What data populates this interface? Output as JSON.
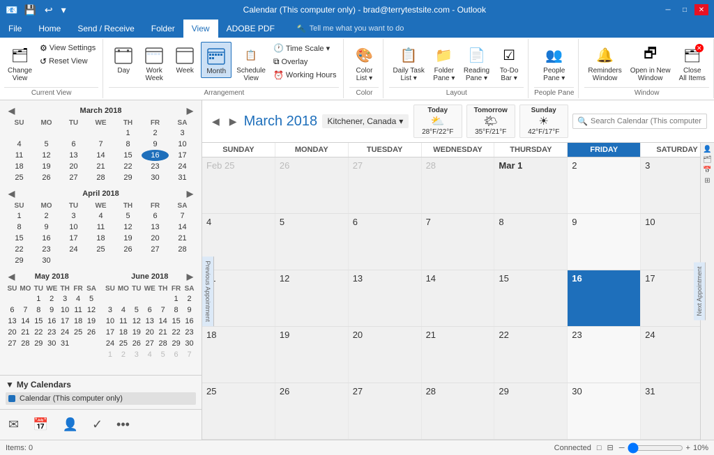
{
  "titleBar": {
    "title": "Calendar (This computer only) - brad@terrytestsite.com - Outlook",
    "controls": [
      "minimize",
      "maximize",
      "close"
    ]
  },
  "quickAccess": {
    "icons": [
      "save",
      "undo",
      "customize"
    ]
  },
  "ribbonTabs": {
    "tabs": [
      "File",
      "Home",
      "Send / Receive",
      "Folder",
      "View",
      "ADOBE PDF"
    ],
    "activeTab": "View",
    "tellMe": "Tell me what you want to do"
  },
  "ribbonGroups": {
    "currentView": {
      "label": "Current View",
      "buttons": [
        {
          "id": "change-view",
          "label": "Change\nView",
          "icon": "🗂"
        },
        {
          "id": "view-settings",
          "label": "View\nSettings",
          "icon": "⚙"
        },
        {
          "id": "reset-view",
          "label": "Reset\nView",
          "icon": "↺"
        }
      ]
    },
    "arrangement": {
      "label": "Arrangement",
      "buttons": [
        {
          "id": "day",
          "label": "Day",
          "icon": "📅"
        },
        {
          "id": "work-week",
          "label": "Work\nWeek",
          "icon": "📅"
        },
        {
          "id": "week",
          "label": "Week",
          "icon": "📅"
        },
        {
          "id": "month",
          "label": "Month",
          "icon": "📅",
          "active": true
        },
        {
          "id": "schedule-view",
          "label": "Schedule\nView",
          "icon": "📋"
        }
      ],
      "smallButtons": [
        {
          "id": "time-scale",
          "label": "Time Scale ▾"
        },
        {
          "id": "overlay",
          "label": "Overlay"
        },
        {
          "id": "working-hours",
          "label": "Working Hours"
        }
      ]
    },
    "color": {
      "label": "Color",
      "buttons": [
        {
          "id": "color",
          "label": "Color\nList ▾",
          "icon": "🎨"
        }
      ]
    },
    "layout": {
      "label": "Layout",
      "buttons": [
        {
          "id": "daily-task-list",
          "label": "Daily Task\nList ▾",
          "icon": "📋"
        },
        {
          "id": "folder-pane",
          "label": "Folder\nPane ▾",
          "icon": "📁"
        },
        {
          "id": "reading-pane",
          "label": "Reading\nPane ▾",
          "icon": "📄"
        },
        {
          "id": "todo-bar",
          "label": "To-Do\nBar ▾",
          "icon": "☑"
        }
      ]
    },
    "peoplePane": {
      "label": "People Pane",
      "buttons": [
        {
          "id": "people-pane",
          "label": "People\nPane ▾",
          "icon": "👥"
        }
      ]
    },
    "window": {
      "label": "Window",
      "buttons": [
        {
          "id": "reminders-window",
          "label": "Reminders\nWindow",
          "icon": "🔔"
        },
        {
          "id": "open-new-window",
          "label": "Open in New\nWindow",
          "icon": "🗗"
        },
        {
          "id": "close-all-items",
          "label": "Close\nAll Items",
          "icon": "✖"
        }
      ]
    }
  },
  "calendar": {
    "title": "March 2018",
    "navPrev": "◀",
    "navNext": "▶",
    "location": "Kitchener, Canada",
    "weather": [
      {
        "day": "Today",
        "icon": "⛅",
        "temp": "28°F/22°F"
      },
      {
        "day": "Tomorrow",
        "icon": "🌤",
        "temp": "35°F/21°F"
      },
      {
        "day": "Sunday",
        "icon": "☀",
        "temp": "42°F/17°F"
      }
    ],
    "searchPlaceholder": "Search Calendar (This computer only)",
    "dayHeaders": [
      "SUNDAY",
      "MONDAY",
      "TUESDAY",
      "WEDNESDAY",
      "THURSDAY",
      "FRIDAY",
      "SATURDAY"
    ],
    "weeks": [
      {
        "cells": [
          {
            "date": "Feb 25",
            "otherMonth": true
          },
          {
            "date": "26",
            "otherMonth": true
          },
          {
            "date": "27",
            "otherMonth": true
          },
          {
            "date": "28",
            "otherMonth": true
          },
          {
            "date": "Mar 1",
            "bold": true
          },
          {
            "date": "2"
          },
          {
            "date": "3"
          }
        ]
      },
      {
        "cells": [
          {
            "date": "4"
          },
          {
            "date": "5"
          },
          {
            "date": "6"
          },
          {
            "date": "7"
          },
          {
            "date": "8"
          },
          {
            "date": "9"
          },
          {
            "date": "10"
          }
        ]
      },
      {
        "cells": [
          {
            "date": "11"
          },
          {
            "date": "12"
          },
          {
            "date": "13"
          },
          {
            "date": "14"
          },
          {
            "date": "15"
          },
          {
            "date": "16",
            "today": true
          },
          {
            "date": "17"
          }
        ]
      },
      {
        "cells": [
          {
            "date": "18"
          },
          {
            "date": "19"
          },
          {
            "date": "20"
          },
          {
            "date": "21"
          },
          {
            "date": "22"
          },
          {
            "date": "23"
          },
          {
            "date": "24"
          }
        ]
      },
      {
        "cells": [
          {
            "date": "25"
          },
          {
            "date": "26"
          },
          {
            "date": "27"
          },
          {
            "date": "28"
          },
          {
            "date": "29"
          },
          {
            "date": "30"
          },
          {
            "date": "31"
          }
        ]
      }
    ]
  },
  "sidebar": {
    "miniCals": [
      {
        "month": "March 2018",
        "dayHeaders": [
          "SU",
          "MO",
          "TU",
          "WE",
          "TH",
          "FR",
          "SA"
        ],
        "weeks": [
          [
            "",
            "",
            "",
            "",
            "1",
            "2",
            "3"
          ],
          [
            "4",
            "5",
            "6",
            "7",
            "8",
            "9",
            "10"
          ],
          [
            "11",
            "12",
            "13",
            "14",
            "15",
            "16",
            "17"
          ],
          [
            "18",
            "19",
            "20",
            "21",
            "22",
            "23",
            "24"
          ],
          [
            "25",
            "26",
            "27",
            "28",
            "29",
            "30",
            "31"
          ],
          [
            "",
            "",
            "",
            "",
            "",
            "",
            ""
          ]
        ],
        "today": "16"
      },
      {
        "month": "April 2018",
        "dayHeaders": [
          "SU",
          "MO",
          "TU",
          "WE",
          "TH",
          "FR",
          "SA"
        ],
        "weeks": [
          [
            "1",
            "2",
            "3",
            "4",
            "5",
            "6",
            "7"
          ],
          [
            "8",
            "9",
            "10",
            "11",
            "12",
            "13",
            "14"
          ],
          [
            "15",
            "16",
            "17",
            "18",
            "19",
            "20",
            "21"
          ],
          [
            "22",
            "23",
            "24",
            "25",
            "26",
            "27",
            "28"
          ],
          [
            "29",
            "30",
            "",
            "",
            "",
            "",
            ""
          ]
        ]
      },
      {
        "month": "May 2018",
        "dayHeaders": [
          "SU",
          "MO",
          "TU",
          "WE",
          "TH",
          "FR",
          "SA"
        ],
        "weeks": [
          [
            "",
            "",
            "1",
            "2",
            "3",
            "4",
            "5"
          ],
          [
            "6",
            "7",
            "8",
            "9",
            "10",
            "11",
            "12"
          ],
          [
            "13",
            "14",
            "15",
            "16",
            "17",
            "18",
            "19"
          ],
          [
            "20",
            "21",
            "22",
            "23",
            "24",
            "25",
            "26"
          ],
          [
            "27",
            "28",
            "29",
            "30",
            "31",
            "",
            ""
          ]
        ]
      },
      {
        "month": "June 2018",
        "dayHeaders": [
          "SU",
          "MO",
          "TU",
          "WE",
          "TH",
          "FR",
          "SA"
        ],
        "weeks": [
          [
            "",
            "",
            "",
            "",
            "",
            "1",
            "2"
          ],
          [
            "3",
            "4",
            "5",
            "6",
            "7",
            "8",
            "9"
          ],
          [
            "10",
            "11",
            "12",
            "13",
            "14",
            "15",
            "16"
          ],
          [
            "17",
            "18",
            "19",
            "20",
            "21",
            "22",
            "23"
          ],
          [
            "24",
            "25",
            "26",
            "27",
            "28",
            "29",
            "30"
          ],
          [
            "1",
            "2",
            "3",
            "4",
            "5",
            "6",
            "7"
          ]
        ]
      }
    ],
    "myCalendars": {
      "label": "My Calendars",
      "items": [
        {
          "label": "Calendar (This computer only)",
          "color": "#1e6fbb"
        }
      ]
    },
    "bottomIcons": [
      "mail",
      "calendar",
      "people",
      "tasks",
      "more"
    ]
  },
  "statusBar": {
    "items": "Items: 0",
    "connectionStatus": "Connected",
    "zoom": "10%"
  },
  "prevAppt": "Previous Appointment",
  "nextAppt": "Next Appointment"
}
